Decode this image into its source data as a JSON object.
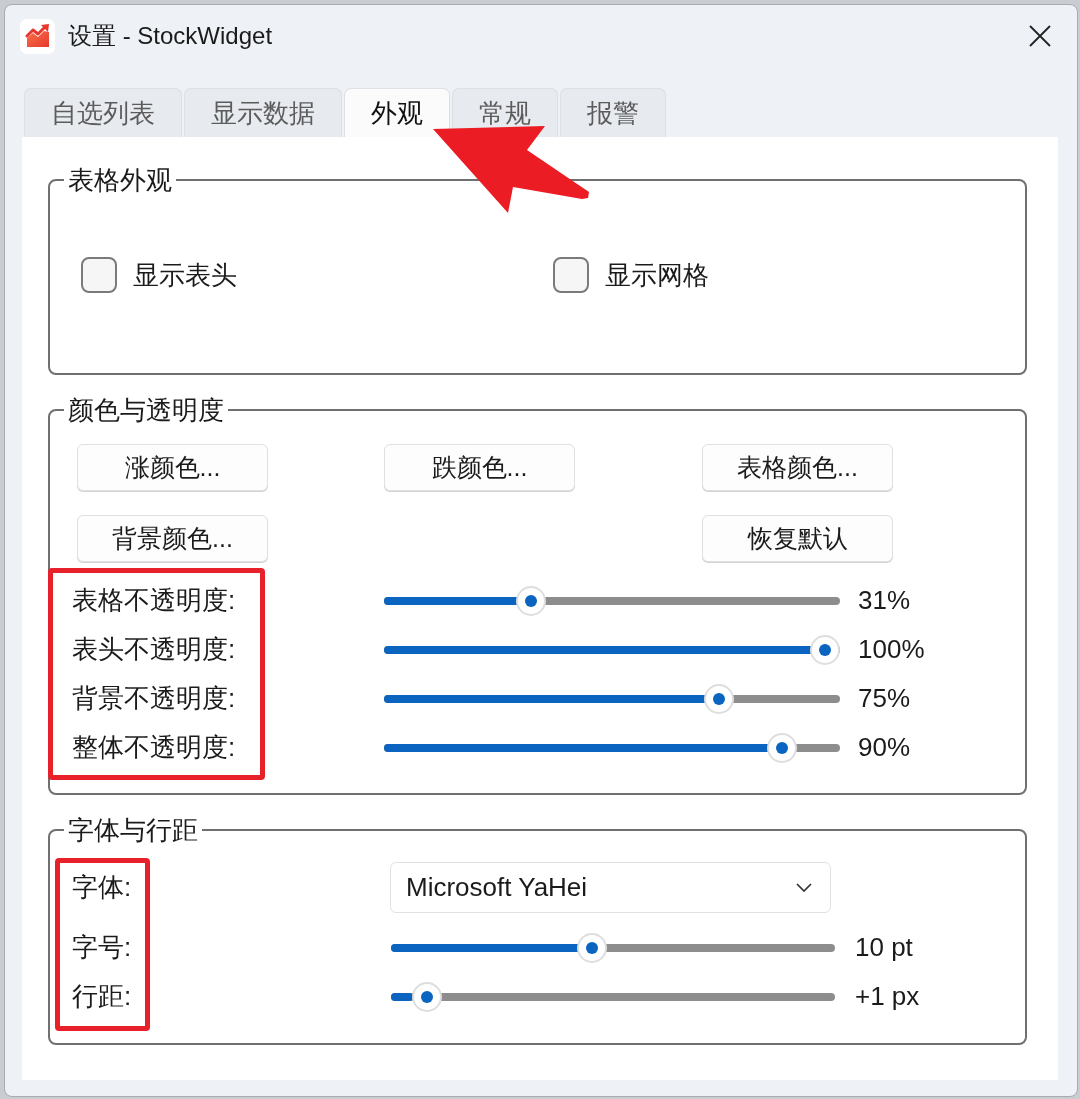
{
  "window": {
    "title": "设置 - StockWidget"
  },
  "tabs": [
    {
      "label": "自选列表",
      "selected": false
    },
    {
      "label": "显示数据",
      "selected": false
    },
    {
      "label": "外观",
      "selected": true
    },
    {
      "label": "常规",
      "selected": false
    },
    {
      "label": "报警",
      "selected": false
    }
  ],
  "annotations": [
    {
      "kind": "arrow"
    }
  ],
  "table_appearance": {
    "title": "表格外观",
    "checkboxes": [
      {
        "label": "显示表头",
        "checked": false
      },
      {
        "label": "显示网格",
        "checked": false
      }
    ]
  },
  "color_opacity": {
    "title": "颜色与透明度",
    "buttons": [
      "涨颜色...",
      "跌颜色...",
      "表格颜色...",
      "背景颜色...",
      "恢复默认"
    ],
    "labels_marked": true,
    "sliders": [
      {
        "label": "表格不透明度:",
        "level": 0.31,
        "reading": "31%"
      },
      {
        "label": "表头不透明度:",
        "level": 1,
        "reading": "100%"
      },
      {
        "label": "背景不透明度:",
        "level": 0.75,
        "reading": "75%"
      },
      {
        "label": "整体不透明度:",
        "level": 0.9,
        "reading": "90%"
      }
    ]
  },
  "font_spacing": {
    "title": "字体与行距",
    "labels_marked": true,
    "font": {
      "label": "字体:",
      "value": "Microsoft YaHei"
    },
    "sliders": [
      {
        "label": "字号:",
        "level": 0.45,
        "reading": "10 pt"
      },
      {
        "label": "行距:",
        "level": 0.05,
        "reading": "+1 px"
      }
    ]
  }
}
